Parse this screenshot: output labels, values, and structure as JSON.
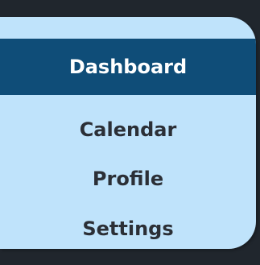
{
  "menu": {
    "items": [
      {
        "label": "Dashboard",
        "active": true
      },
      {
        "label": "Calendar",
        "active": false
      },
      {
        "label": "Profile",
        "active": false
      },
      {
        "label": "Settings",
        "active": false
      }
    ]
  },
  "colors": {
    "background": "#20262d",
    "panel": "#bfe3fb",
    "active_item": "#0f4d78",
    "active_text": "#ffffff",
    "text": "#2b2f36"
  }
}
